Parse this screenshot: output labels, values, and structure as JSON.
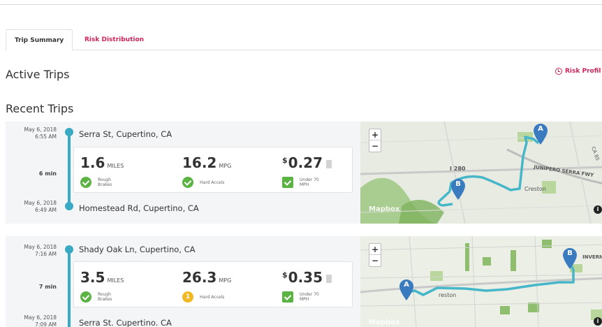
{
  "tabs": [
    {
      "label": "Trip Summary",
      "active": true
    },
    {
      "label": "Risk Distribution",
      "active": false
    }
  ],
  "sections": {
    "active_title": "Active Trips",
    "recent_title": "Recent Trips"
  },
  "risk_profile": {
    "label": "Risk Profil",
    "icon": "clock-icon"
  },
  "trips": [
    {
      "start_date": "May 6, 2018",
      "start_time": "6:55 AM",
      "start_address": "Serra St, Cupertino, CA",
      "duration": "6 min",
      "end_date": "May 6, 2018",
      "end_time": "6:49 AM",
      "end_address": "Homestead Rd, Cupertino, CA",
      "distance": "1.6",
      "distance_unit": "MILES",
      "mpg": "16.2",
      "mpg_unit": "MPG",
      "cost_symbol": "$",
      "cost": "0.27",
      "badges": [
        {
          "label": "Rough Brakes",
          "status": "ok"
        },
        {
          "label": "Hard Accels",
          "status": "ok"
        },
        {
          "label": "Under 70 MPH",
          "status": "ok"
        }
      ],
      "map": {
        "zoom_in": "+",
        "zoom_out": "−",
        "logo": "Mapbox",
        "info": "i",
        "road_label_1": "I 280",
        "road_label_2": "JUNIPERO SERRA FWY",
        "place_label": "Creston",
        "road_label_3": "CA 85",
        "marker_a": "A",
        "marker_b": "B"
      }
    },
    {
      "start_date": "May 6, 2018",
      "start_time": "7:16 AM",
      "start_address": "Shady Oak Ln, Cupertino, CA",
      "duration": "7 min",
      "end_date": "May 6, 2018",
      "end_time": "7:09 AM",
      "end_address": "Serra St. Cupertino. CA",
      "distance": "3.5",
      "distance_unit": "MILES",
      "mpg": "26.3",
      "mpg_unit": "MPG",
      "cost_symbol": "$",
      "cost": "0.35",
      "badges": [
        {
          "label": "Rough Brakes",
          "status": "ok"
        },
        {
          "label": "Hard Accels",
          "status": "warn",
          "count": "1"
        },
        {
          "label": "Under 70 MPH",
          "status": "ok"
        }
      ],
      "map": {
        "zoom_in": "+",
        "zoom_out": "−",
        "logo": "Mapbox",
        "info": "i",
        "place_label": "reston",
        "road_label_1": "INVERN",
        "marker_a": "A",
        "marker_b": "B"
      }
    }
  ],
  "colors": {
    "accent": "#d0245a",
    "timeline": "#3aa9c4",
    "ok": "#5bb344",
    "warn": "#f2b824",
    "route": "#46b6c9",
    "marker": "#3a7bbf"
  }
}
